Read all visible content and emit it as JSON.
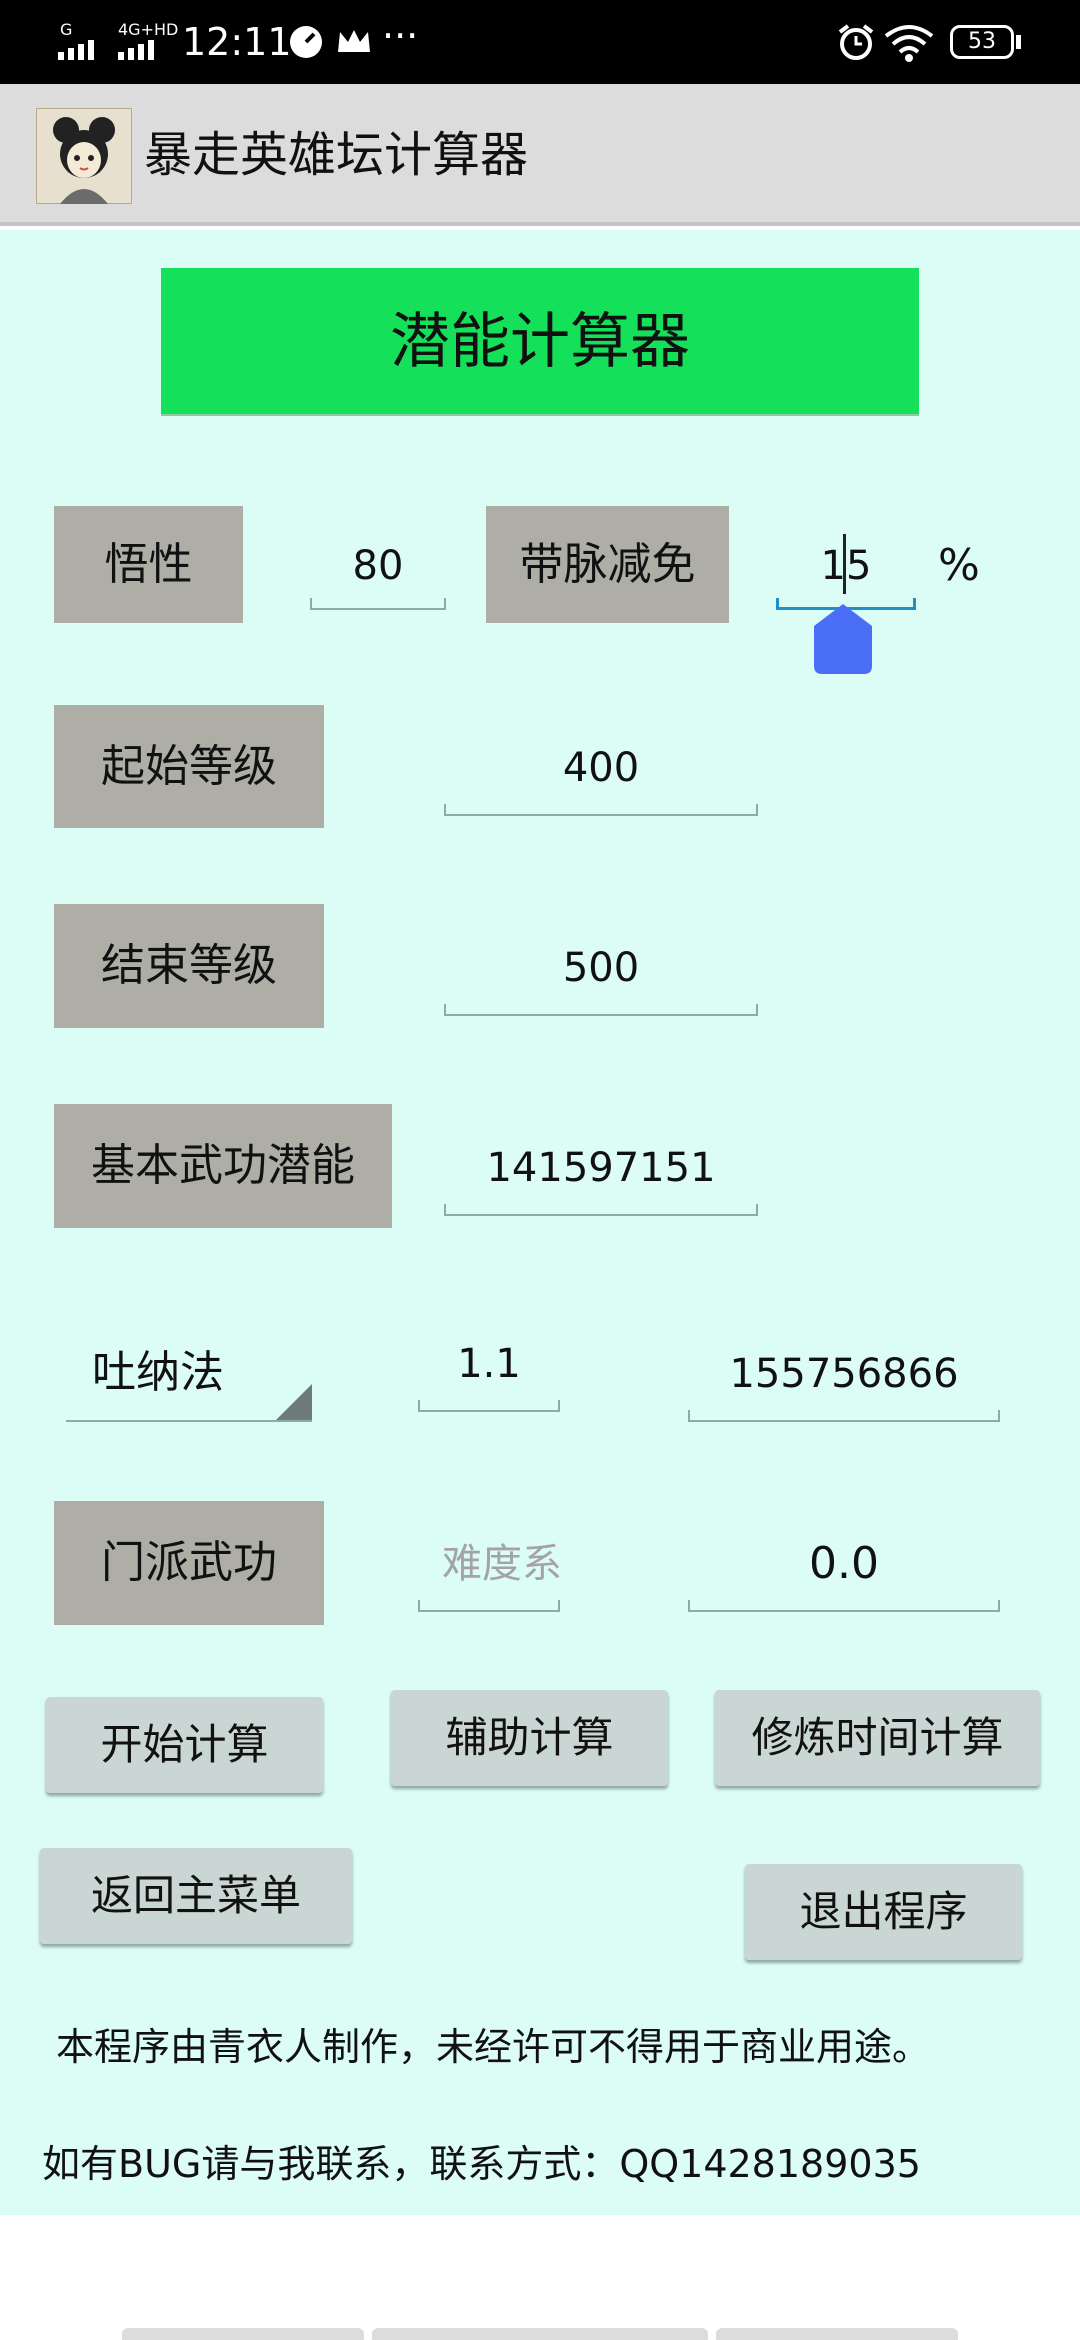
{
  "status_bar": {
    "network_top": "G",
    "network_top2": "4G+HD",
    "time": "12:11",
    "more": "···",
    "battery": "53"
  },
  "app_bar": {
    "title": "暴走英雄坛计算器"
  },
  "banner": {
    "title": "潜能计算器"
  },
  "rows": {
    "wuxing_label": "悟性",
    "wuxing_value": "80",
    "daimai_label": "带脉减免",
    "daimai_value": "15",
    "percent": "%",
    "start_label": "起始等级",
    "start_value": "400",
    "end_label": "结束等级",
    "end_value": "500",
    "basic_label": "基本武功潜能",
    "basic_value": "141597151",
    "method_select": "吐纳法",
    "method_multiplier": "1.1",
    "method_result": "155756866",
    "sect_label": "门派武功",
    "sect_difficulty_placeholder": "难度系",
    "sect_result": "0.0"
  },
  "buttons": {
    "start": "开始计算",
    "assist": "辅助计算",
    "train_time": "修炼时间计算",
    "back_menu": "返回主菜单",
    "exit": "退出程序"
  },
  "notes": {
    "line1": "本程序由青衣人制作，未经许可不得用于商业用途。",
    "line2": "如有BUG请与我联系，联系方式：QQ1428189035"
  },
  "colors": {
    "content_bg": "#dcfcf6",
    "banner_bg": "#14e05a",
    "label_bg": "#aeaea7",
    "button_bg": "#c9d6d3",
    "cursor_handle": "#4a6ef5"
  }
}
